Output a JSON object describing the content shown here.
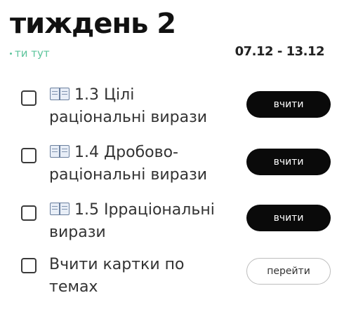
{
  "header": {
    "title": "тиждень 2",
    "here_label": "ти тут",
    "date_range": "07.12 - 13.12"
  },
  "tasks": [
    {
      "line1": "1.3 Цілі",
      "line2": "раціональні вирази",
      "button": "вчити",
      "icon": "open-book-icon"
    },
    {
      "line1": "1.4 Дробово-",
      "line2": "раціональні вирази",
      "button": "вчити",
      "icon": "open-book-icon"
    },
    {
      "line1": "1.5 Ірраціональні",
      "line2": "вирази",
      "button": "вчити",
      "icon": "open-book-icon"
    },
    {
      "line1": "Вчити картки по",
      "line2": "темах",
      "button": "перейти"
    }
  ],
  "colors": {
    "accent_green": "#5cc49b",
    "button_dark": "#0a0a0a",
    "text": "#333333"
  }
}
